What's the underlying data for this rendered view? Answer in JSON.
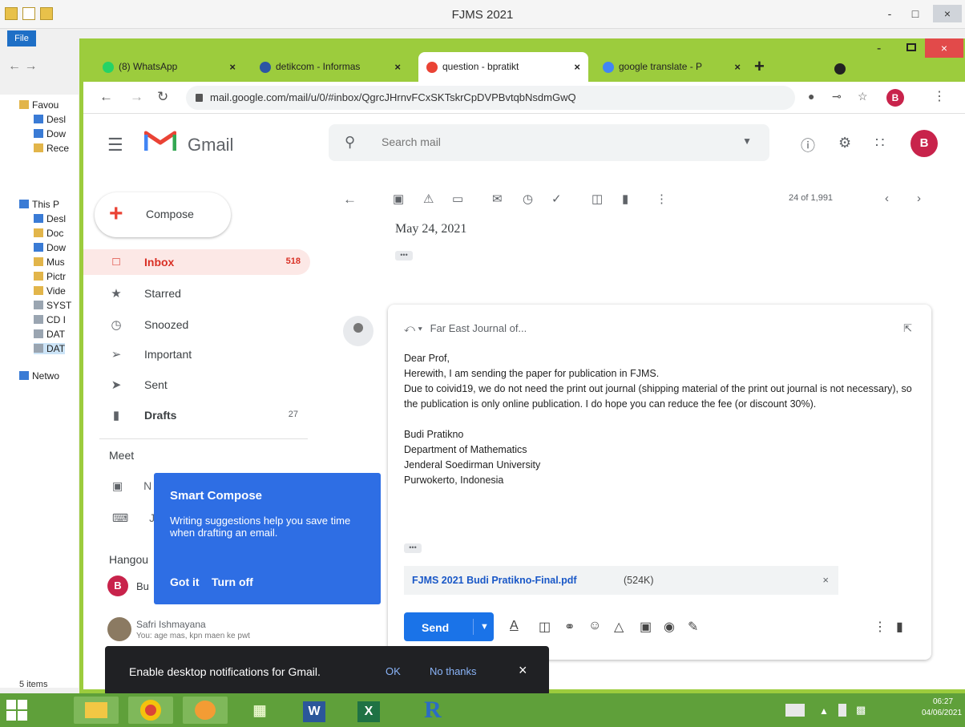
{
  "explorer": {
    "title": "FJMS 2021",
    "file_tab": "File",
    "nav_arrows": "← →",
    "tree": [
      "Favou",
      "Desl",
      "Dow",
      "Rece",
      "This P",
      "Desl",
      "Doc",
      "Dow",
      "Mus",
      "Pictr",
      "Vide",
      "SYST",
      "CD I",
      "DAT",
      "DAT",
      "Netwo"
    ],
    "items_count": "5 items",
    "window_controls": [
      "-",
      "□",
      "×"
    ]
  },
  "chrome": {
    "tabs": [
      {
        "label": "(8) WhatsApp",
        "favicon": "whatsapp-icon",
        "color": "#25d366"
      },
      {
        "label": "detikcom - Informas",
        "favicon": "detik-icon",
        "color": "#2c55a4"
      },
      {
        "label": "question - bpratikt",
        "favicon": "gmail-icon",
        "color": "#ea4335"
      },
      {
        "label": "google translate - P",
        "favicon": "google-icon",
        "color": "#4285f4"
      }
    ],
    "tab_close": "×",
    "new_tab": "+",
    "url": "mail.google.com/mail/u/0/#inbox/QgrcJHrnvFCxSKTskrCpDVPBvtqbNsdmGwQ",
    "profile_initial": "B",
    "window_controls": [
      "-",
      "□",
      "×"
    ]
  },
  "gmail": {
    "brand": "Gmail",
    "search_placeholder": "Search mail",
    "account_initial": "B",
    "compose_label": "Compose",
    "nav": [
      {
        "label": "Inbox",
        "count": "518",
        "icon": "inbox-icon"
      },
      {
        "label": "Starred",
        "count": "",
        "icon": "star-icon"
      },
      {
        "label": "Snoozed",
        "count": "",
        "icon": "clock-icon"
      },
      {
        "label": "Important",
        "count": "",
        "icon": "important-icon"
      },
      {
        "label": "Sent",
        "count": "",
        "icon": "send-icon"
      },
      {
        "label": "Drafts",
        "count": "27",
        "icon": "draft-icon"
      }
    ],
    "meet_heading": "Meet",
    "meet_items": [
      "N",
      "J"
    ],
    "hangouts_heading": "Hangou",
    "hangout_user": "Bu",
    "contact": {
      "name": "Safri Ishmayana",
      "message": "You: age mas, kpn maen ke pwt"
    },
    "smart_compose": {
      "title": "Smart Compose",
      "body": "Writing suggestions help you save time when drafting an email.",
      "got_it": "Got it",
      "turn_off": "Turn off"
    },
    "pager": "24 of 1,991",
    "message_date": "May 24, 2021",
    "ellipsis": "•••",
    "reply": {
      "recipient": "Far East Journal of...",
      "salutation": "Dear Prof,",
      "line1": "Herewith, I am sending the paper for publication in FJMS.",
      "line2": "Due to coivid19, we do not need the print out journal (shipping material of the print out journal is not necessary), so the publication is only online publication. I do hope you can reduce the fee (or discount 30%).",
      "signature": [
        "Budi Pratikno",
        "Department of Mathematics",
        "Jenderal Soedirman University",
        "Purwokerto, Indonesia"
      ],
      "attachment_name": "FJMS 2021 Budi Pratikno-Final.pdf",
      "attachment_size": "(524K)",
      "send_label": "Send"
    },
    "notification": {
      "text": "Enable desktop notifications for Gmail.",
      "ok": "OK",
      "no_thanks": "No thanks",
      "close": "×"
    }
  },
  "taskbar": {
    "apps": [
      "explorer",
      "chrome",
      "paint",
      "excel-chart",
      "word",
      "excel",
      "r"
    ],
    "time": "06:27",
    "date": "04/06/2021"
  },
  "colors": {
    "chrome_frame": "#9ccc3d",
    "taskbar": "#5fa03a",
    "gmail_red": "#d93025",
    "send_blue": "#1a73e8",
    "smart_compose_blue": "#2e6ee4"
  }
}
